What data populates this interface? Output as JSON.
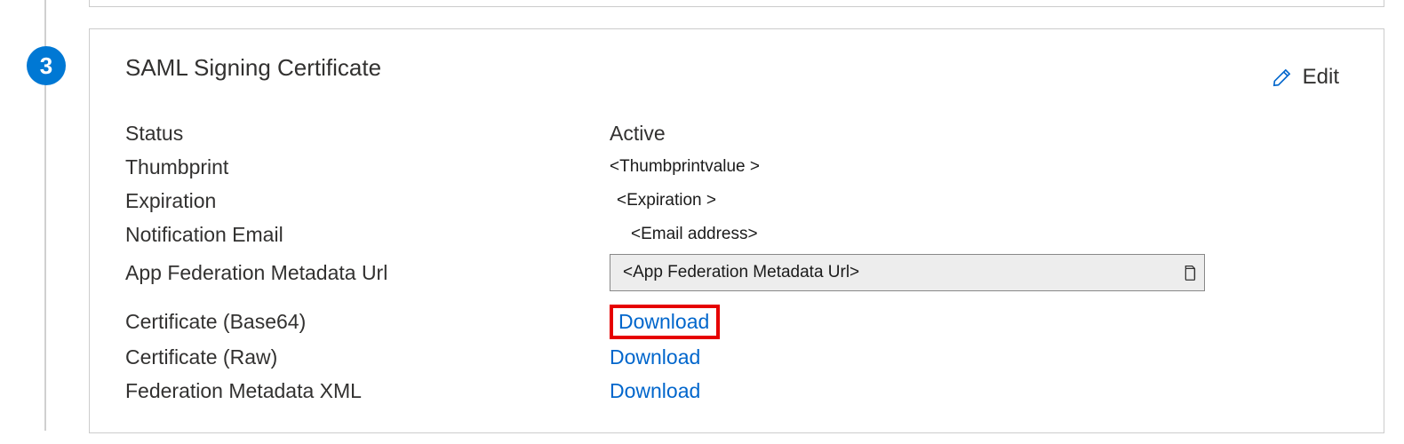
{
  "step": {
    "number": "3"
  },
  "card": {
    "title": "SAML Signing Certificate",
    "edit_label": "Edit",
    "rows": {
      "status": {
        "label": "Status",
        "value": "Active"
      },
      "thumbprint": {
        "label": "Thumbprint",
        "value": "<Thumbprintvalue >"
      },
      "expiration": {
        "label": "Expiration",
        "value": "<Expiration >"
      },
      "notification_email": {
        "label": "Notification Email",
        "value": "<Email address>"
      },
      "app_fed_url": {
        "label": "App Federation Metadata Url",
        "value": "<App Federation Metadata Url>"
      },
      "cert_base64": {
        "label": "Certificate (Base64)",
        "action": "Download"
      },
      "cert_raw": {
        "label": "Certificate (Raw)",
        "action": "Download"
      },
      "fed_xml": {
        "label": "Federation Metadata XML",
        "action": "Download"
      }
    }
  }
}
